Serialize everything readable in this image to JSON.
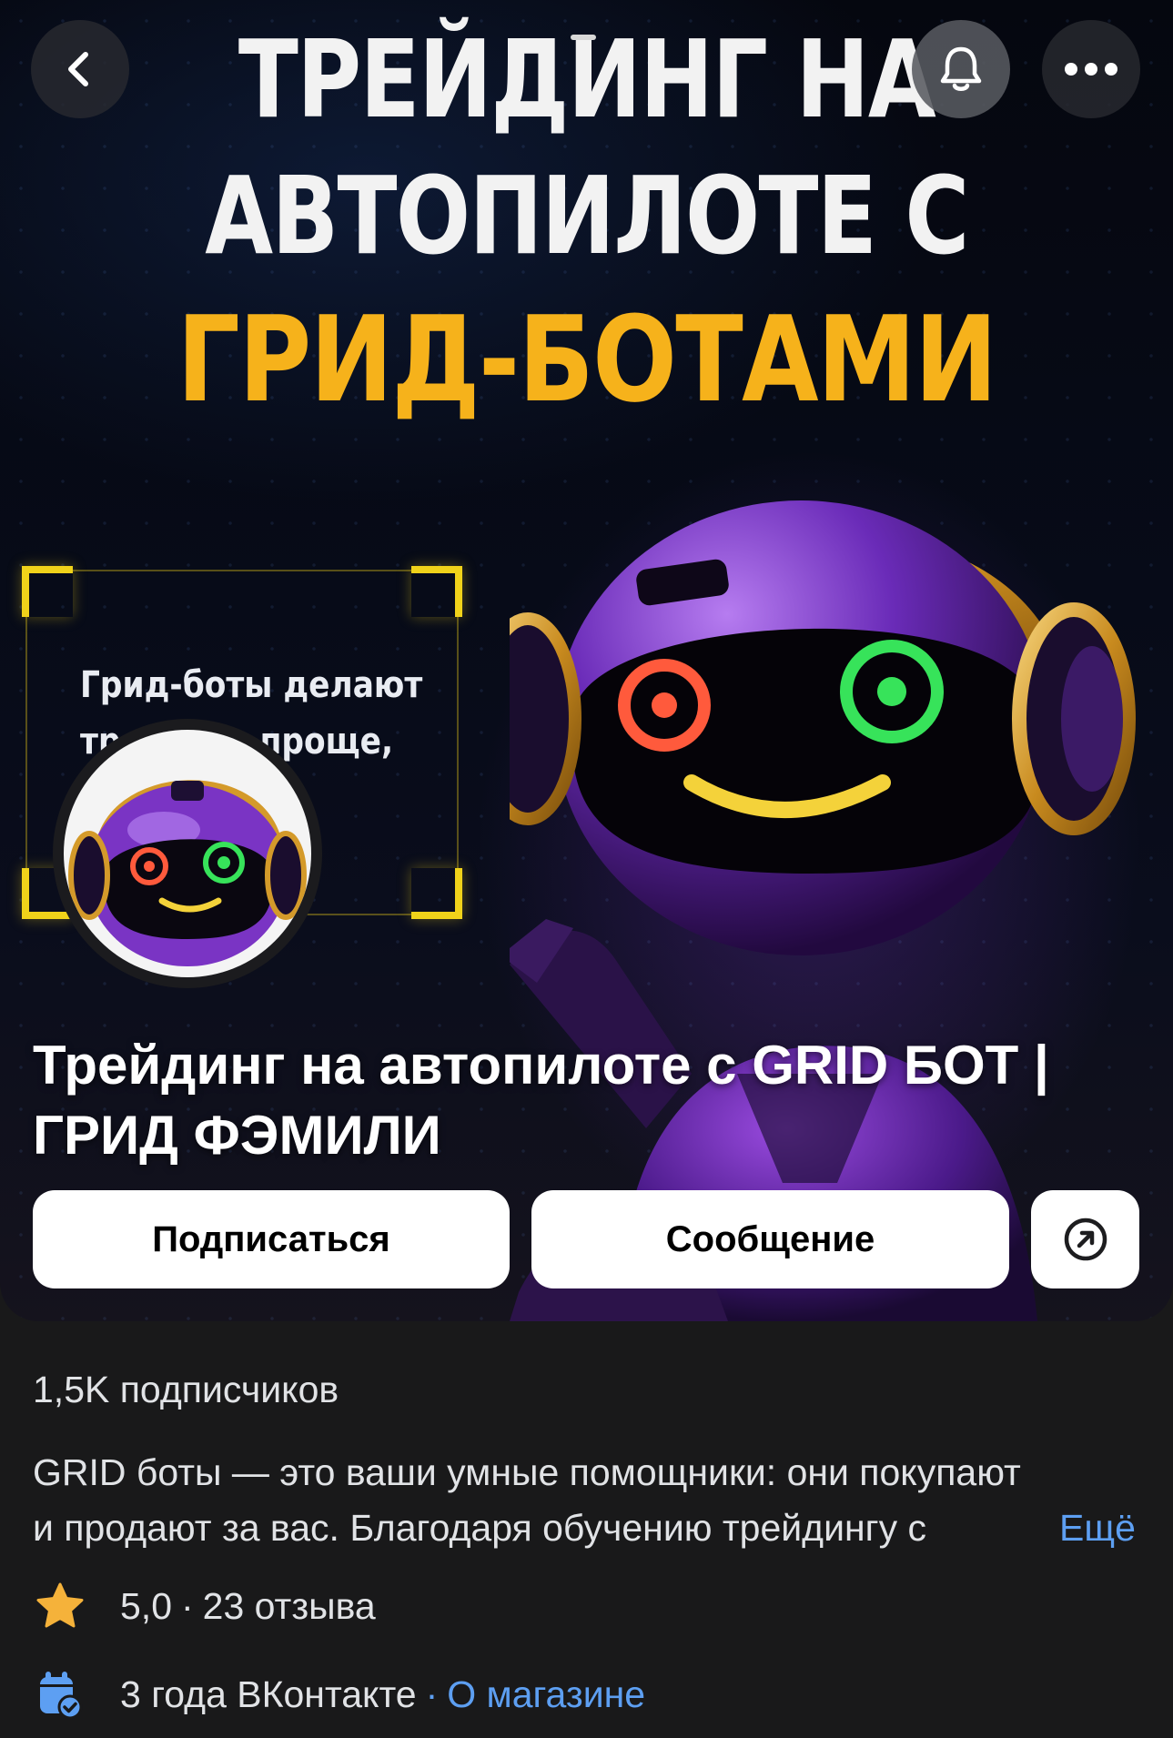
{
  "cover": {
    "headline_line1": "ТРЕЙДИНГ НА",
    "headline_line2": "АВТОПИЛОТЕ С",
    "headline_line3": "ГРИД-БОТАМИ",
    "frame_text": "Грид-боты делают\nтрейдинг проще,\nбыстрее",
    "colors": {
      "headline": "#f2f2f2",
      "headline_accent": "#f6b21b",
      "frame": "#f0d21a"
    }
  },
  "top_bar": {
    "back_icon": "chevron-left-icon",
    "bell_icon": "bell-icon",
    "more_icon": "more-horizontal-icon"
  },
  "community": {
    "title": "Трейдинг на автопилоте с GRID БОТ | ГРИД ФЭМИЛИ",
    "subscribe_label": "Подписаться",
    "message_label": "Сообщение",
    "share_icon": "share-arrow-icon"
  },
  "info": {
    "subscribers": "1,5K подписчиков",
    "description_line1": "GRID боты — это ваши умные помощники: они покупают",
    "description_line2": "и продают за вас. Благодаря обучению трейдингу с",
    "more_label": "Ещё",
    "rating": "5,0",
    "rating_sep": "·",
    "reviews": "23 отзыва",
    "age": "3 года ВКонтакте",
    "age_sep": "·",
    "about_link": "О магазине",
    "colors": {
      "link": "#5d9ff2",
      "star": "#f5b23a",
      "calendar": "#5d9ff2"
    }
  }
}
